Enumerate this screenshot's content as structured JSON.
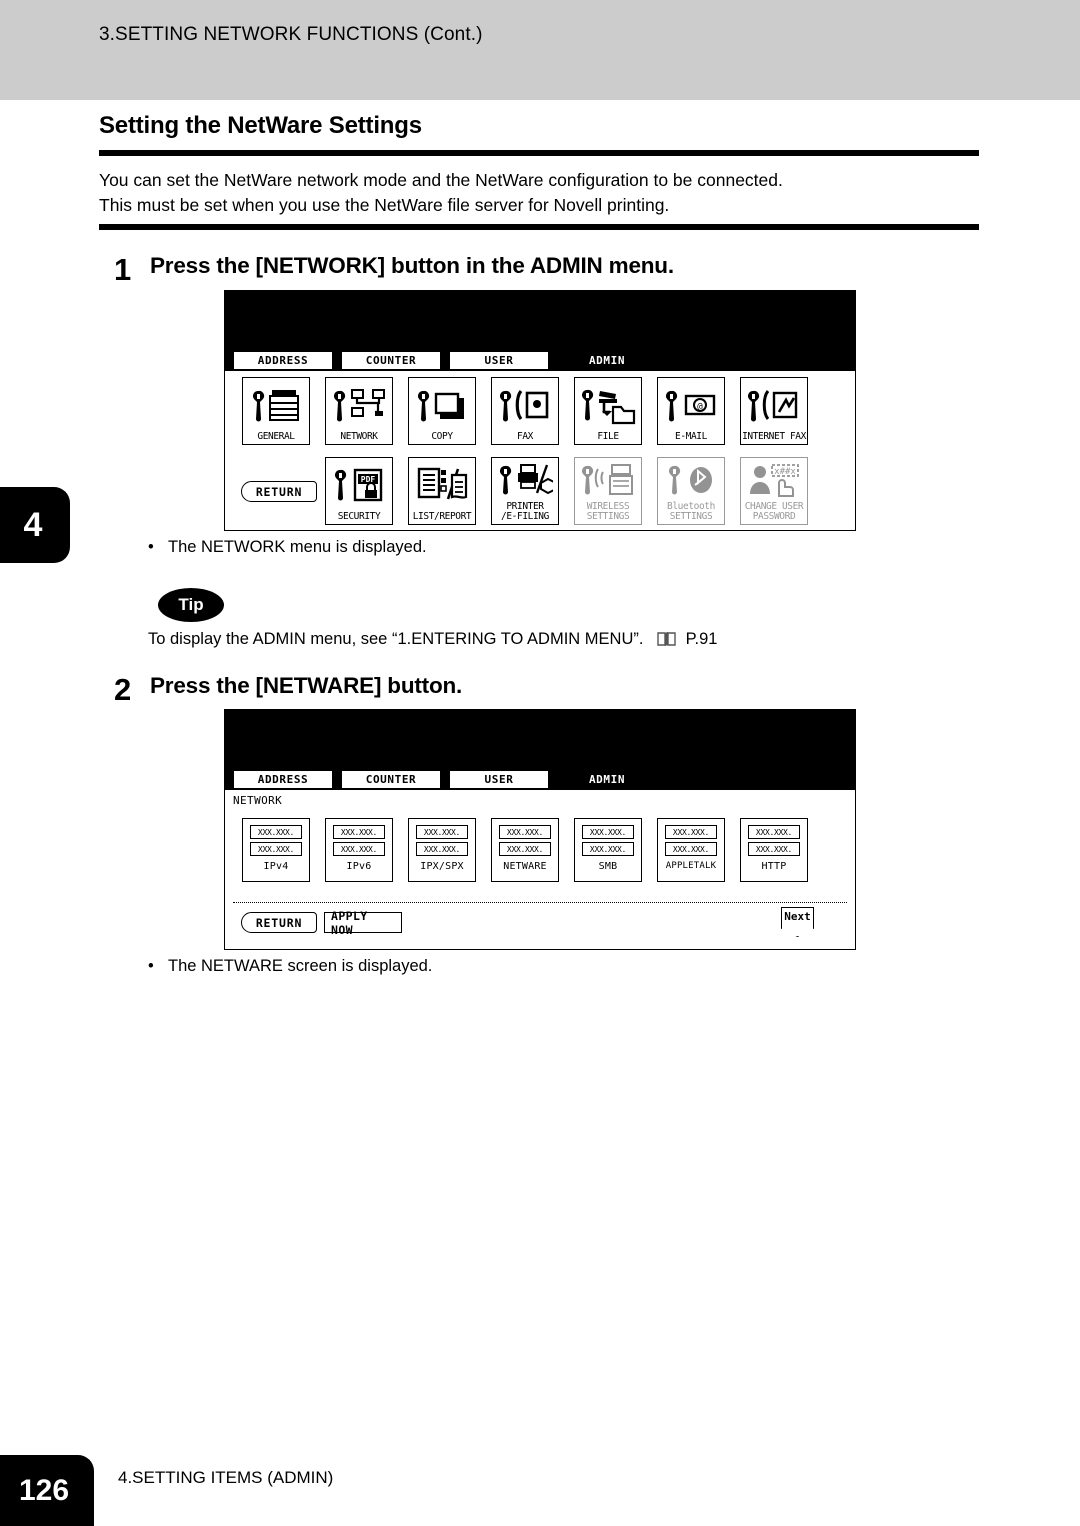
{
  "running_head": "3.SETTING NETWORK FUNCTIONS (Cont.)",
  "chapter_tab": "4",
  "section": {
    "title": "Setting the NetWare Settings",
    "lede_line1": "You can set the NetWare network mode and the NetWare configuration to be connected.",
    "lede_line2": "This must be set when you use the NetWare file server for Novell printing."
  },
  "steps": [
    {
      "number": "1",
      "title": "Press the [NETWORK] button in the ADMIN menu.",
      "note": "The NETWORK menu is displayed."
    },
    {
      "number": "2",
      "title": "Press the [NETWARE] button.",
      "note": "The NETWARE screen is displayed."
    }
  ],
  "tip": {
    "badge": "Tip",
    "text_before": "To display the ADMIN menu, see “1.ENTERING TO ADMIN MENU”.",
    "book_icon": "open-book-icon",
    "page_ref": "P.91"
  },
  "panel1": {
    "tabs": [
      {
        "label": "ADDRESS",
        "selected": false
      },
      {
        "label": "COUNTER",
        "selected": false
      },
      {
        "label": "USER",
        "selected": false
      },
      {
        "label": "ADMIN",
        "selected": true
      }
    ],
    "row1": [
      {
        "label": "GENERAL",
        "icon": "wrench-copier-icon",
        "disabled": false
      },
      {
        "label": "NETWORK",
        "icon": "wrench-network-icon",
        "disabled": false
      },
      {
        "label": "COPY",
        "icon": "wrench-copy-icon",
        "disabled": false
      },
      {
        "label": "FAX",
        "icon": "wrench-fax-icon",
        "disabled": false
      },
      {
        "label": "FILE",
        "icon": "wrench-file-icon",
        "disabled": false
      },
      {
        "label": "E-MAIL",
        "icon": "wrench-email-icon",
        "disabled": false
      },
      {
        "label": "INTERNET FAX",
        "icon": "wrench-internet-fax-icon",
        "disabled": false
      }
    ],
    "row2": [
      {
        "label": "SECURITY",
        "icon": "wrench-pdf-lock-icon",
        "disabled": false
      },
      {
        "label": "LIST/REPORT",
        "icon": "list-report-icon",
        "disabled": false
      },
      {
        "label": "PRINTER\n/E-FILING",
        "icon": "wrench-printer-efiling-icon",
        "disabled": false
      },
      {
        "label": "WIRELESS\nSETTINGS",
        "icon": "wrench-wireless-icon",
        "disabled": true
      },
      {
        "label": "Bluetooth\nSETTINGS",
        "icon": "wrench-bluetooth-icon",
        "disabled": true
      },
      {
        "label": "CHANGE USER\nPASSWORD",
        "icon": "change-user-password-icon",
        "disabled": true
      }
    ],
    "return_label": "RETURN"
  },
  "panel2": {
    "tabs": [
      {
        "label": "ADDRESS",
        "selected": false
      },
      {
        "label": "COUNTER",
        "selected": false
      },
      {
        "label": "USER",
        "selected": false
      },
      {
        "label": "ADMIN",
        "selected": true
      }
    ],
    "screen_label": "NETWORK",
    "field_value": "XXX.XXX.",
    "buttons": [
      {
        "label": "IPv4"
      },
      {
        "label": "IPv6"
      },
      {
        "label": "IPX/SPX"
      },
      {
        "label": "NETWARE"
      },
      {
        "label": "SMB"
      },
      {
        "label": "APPLETALK"
      },
      {
        "label": "HTTP"
      }
    ],
    "return_label": "RETURN",
    "apply_label": "APPLY NOW",
    "next_label": "Next"
  },
  "footer": {
    "page_number": "126",
    "chapter_title": "4.SETTING ITEMS (ADMIN)"
  }
}
